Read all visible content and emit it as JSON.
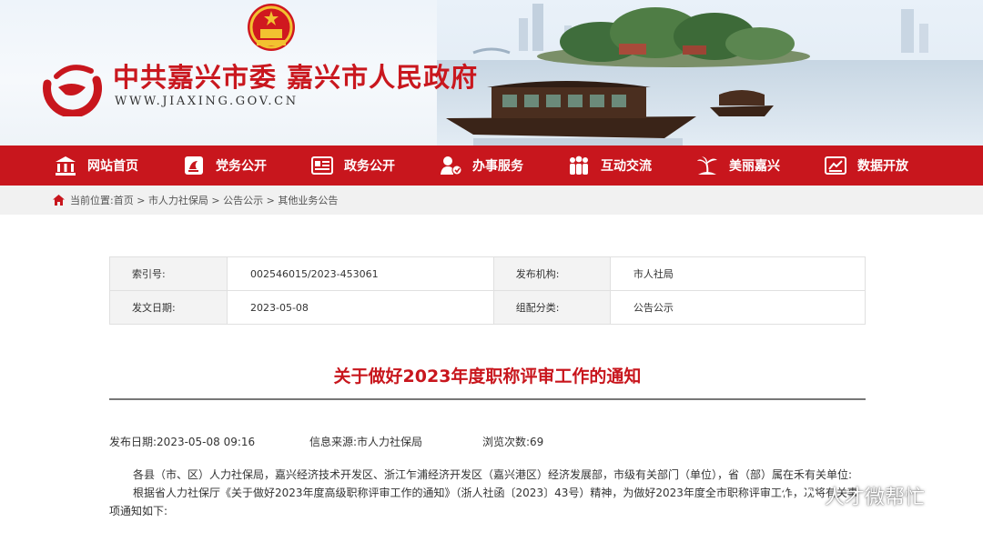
{
  "header": {
    "site_title": "中共嘉兴市委 嘉兴市人民政府",
    "site_url": "WWW.JIAXING.GOV.CN",
    "brand_color": "#c8161d"
  },
  "nav": {
    "items": [
      {
        "label": "网站首页",
        "icon": "building-icon"
      },
      {
        "label": "党务公开",
        "icon": "party-flag-icon"
      },
      {
        "label": "政务公开",
        "icon": "document-icon"
      },
      {
        "label": "办事服务",
        "icon": "service-icon"
      },
      {
        "label": "互动交流",
        "icon": "people-icon"
      },
      {
        "label": "美丽嘉兴",
        "icon": "palm-tree-icon"
      },
      {
        "label": "数据开放",
        "icon": "data-screen-icon"
      }
    ]
  },
  "breadcrumb": {
    "prefix": "当前位置:",
    "items": [
      "首页",
      "市人力社保局",
      "公告公示",
      "其他业务公告"
    ],
    "separator": " > "
  },
  "meta": {
    "index_label": "索引号:",
    "index_value": "002546015/2023-453061",
    "publisher_label": "发布机构:",
    "publisher_value": "市人社局",
    "date_label": "发文日期:",
    "date_value": "2023-05-08",
    "category_label": "组配分类:",
    "category_value": "公告公示"
  },
  "article": {
    "title": "关于做好2023年度职称评审工作的通知",
    "publish_date_label": "发布日期:",
    "publish_date": "2023-05-08 09:16",
    "source_label": "信息来源:",
    "source": "市人力社保局",
    "views_label": "浏览次数:",
    "views": "69",
    "paragraphs": [
      "各县（市、区）人力社保局，嘉兴经济技术开发区、浙江乍浦经济开发区（嘉兴港区）经济发展部，市级有关部门（单位），省（部）属在禾有关单位:",
      "根据省人力社保厅《关于做好2023年度高级职称评审工作的通知》（浙人社函〔2023〕43号）精神，为做好2023年度全市职称评审工作，现将有关事项通知如下:"
    ]
  },
  "watermark": {
    "text": "人才微帮忙"
  }
}
